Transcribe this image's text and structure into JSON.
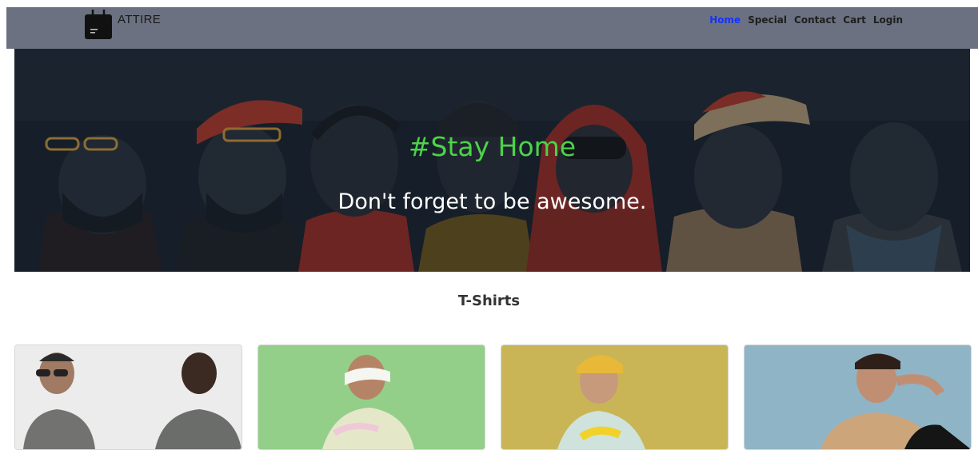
{
  "navbar": {
    "brand": "ATTIRE",
    "links": [
      {
        "label": "Home",
        "active": true
      },
      {
        "label": "Special",
        "active": false
      },
      {
        "label": "Contact",
        "active": false
      },
      {
        "label": "Cart",
        "active": false
      },
      {
        "label": "Login",
        "active": false
      }
    ]
  },
  "hero": {
    "title": "#Stay Home",
    "subtitle": "Don't forget to be awesome."
  },
  "section": {
    "title": "T-Shirts"
  },
  "products": [
    {
      "image": "man-in-sunglasses-grey-tshirt",
      "bg": "#ececec"
    },
    {
      "image": "man-in-white-visor-tie-dye-tshirt",
      "bg": "#8fcf86"
    },
    {
      "image": "man-in-yellow-cap-printed-tshirt",
      "bg": "#c9b555"
    },
    {
      "image": "man-in-beige-tshirt",
      "bg": "#8fb4c6"
    }
  ],
  "colors": {
    "navbar_bg": "#6b7180",
    "active_link": "#1533ff",
    "hero_title": "#4cd34a"
  }
}
